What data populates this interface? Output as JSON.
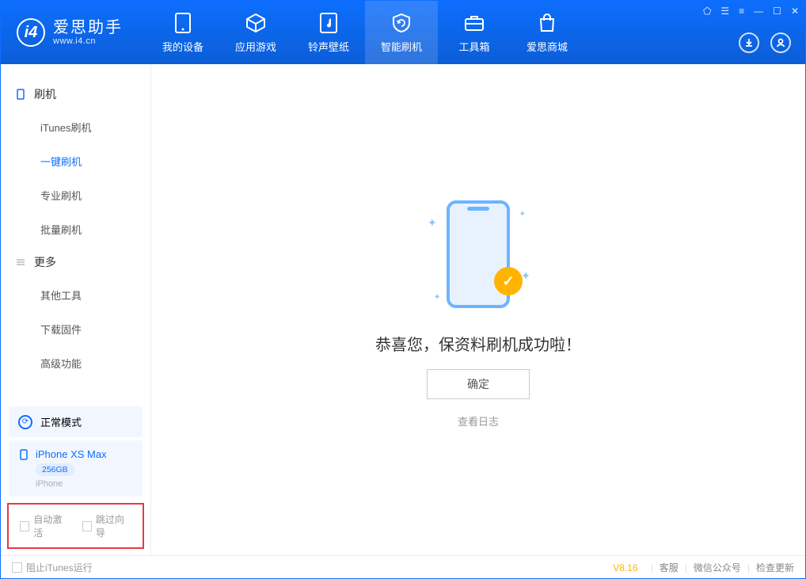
{
  "app": {
    "name": "爱思助手",
    "url": "www.i4.cn"
  },
  "nav": {
    "items": [
      {
        "label": "我的设备"
      },
      {
        "label": "应用游戏"
      },
      {
        "label": "铃声壁纸"
      },
      {
        "label": "智能刷机"
      },
      {
        "label": "工具箱"
      },
      {
        "label": "爱思商城"
      }
    ]
  },
  "sidebar": {
    "group1_title": "刷机",
    "group1_items": [
      "iTunes刷机",
      "一键刷机",
      "专业刷机",
      "批量刷机"
    ],
    "group2_title": "更多",
    "group2_items": [
      "其他工具",
      "下载固件",
      "高级功能"
    ]
  },
  "device": {
    "mode": "正常模式",
    "name": "iPhone XS Max",
    "capacity": "256GB",
    "type": "iPhone"
  },
  "options": {
    "auto_activate": "自动激活",
    "skip_guide": "跳过向导"
  },
  "main": {
    "success_text": "恭喜您，保资料刷机成功啦！",
    "ok_button": "确定",
    "view_log": "查看日志"
  },
  "footer": {
    "block_itunes": "阻止iTunes运行",
    "version": "V8.16",
    "customer_service": "客服",
    "wechat": "微信公众号",
    "check_update": "检查更新"
  }
}
